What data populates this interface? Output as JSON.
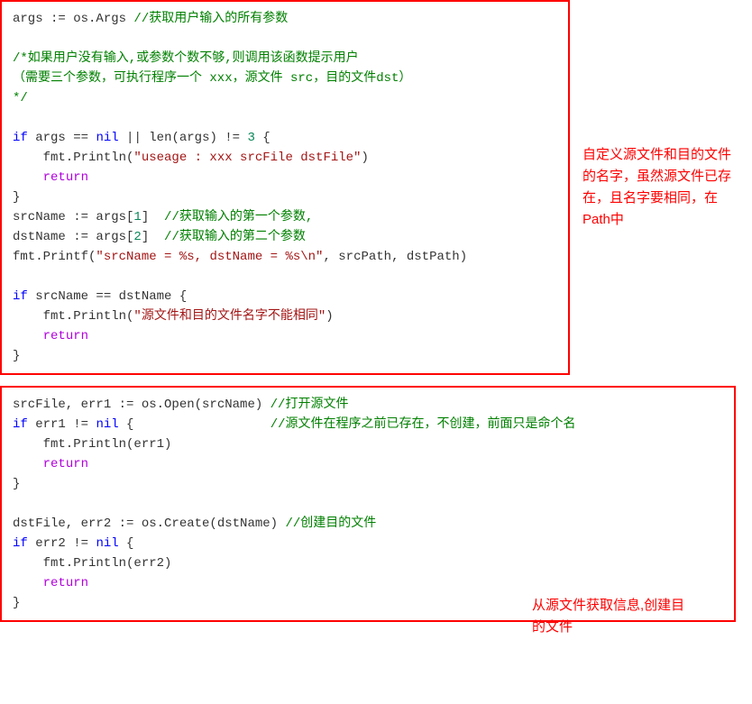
{
  "blocks": {
    "b1": {
      "l1_a": "args := os.Args ",
      "l1_c": "//获取用户输入的所有参数",
      "l2": "",
      "l3_c": "/*如果用户没有输入,或参数个数不够,则调用该函数提示用户",
      "l4_c": "（需要三个参数，可执行程序一个 xxx，源文件 src，目的文件dst）",
      "l5_c": "*/",
      "l6": "",
      "l7_a": "if",
      "l7_b": " args == ",
      "l7_nil": "nil",
      "l7_c": " || len(args) != ",
      "l7_num": "3",
      "l7_d": " {",
      "l8_a": "    fmt.Println(",
      "l8_s": "\"useage : xxx srcFile dstFile\"",
      "l8_b": ")",
      "l9_a": "    ",
      "l9_ret": "return",
      "l10": "}",
      "l11_a": "srcName := args[",
      "l11_n": "1",
      "l11_b": "]  ",
      "l11_c": "//获取输入的第一个参数,",
      "l12_a": "dstName := args[",
      "l12_n": "2",
      "l12_b": "]  ",
      "l12_c": "//获取输入的第二个参数",
      "l13_a": "fmt.Printf(",
      "l13_s": "\"srcName = %s, dstName = %s\\n\"",
      "l13_b": ", srcPath, dstPath)",
      "l14": "",
      "l15_a": "if",
      "l15_b": " srcName == dstName {",
      "l16_a": "    fmt.Println(",
      "l16_s": "\"源文件和目的文件名字不能相同\"",
      "l16_b": ")",
      "l17_a": "    ",
      "l17_ret": "return",
      "l18": "}"
    },
    "b2": {
      "l1_a": "srcFile, err1 := os.Open(srcName) ",
      "l1_c": "//打开源文件",
      "l2_a": "if",
      "l2_b": " err1 != ",
      "l2_nil": "nil",
      "l2_c": " {                  ",
      "l2_cmt": "//源文件在程序之前已存在，不创建，前面只是命个名",
      "l3": "    fmt.Println(err1)",
      "l4_a": "    ",
      "l4_ret": "return",
      "l5": "}",
      "l6": "",
      "l7_a": "dstFile, err2 := os.Create(dstName) ",
      "l7_c": "//创建目的文件",
      "l8_a": "if",
      "l8_b": " err2 != ",
      "l8_nil": "nil",
      "l8_c": " {",
      "l9": "    fmt.Println(err2)",
      "l10_a": "    ",
      "l10_ret": "return",
      "l11": "}"
    }
  },
  "annotations": {
    "a1": "自定义源文件和目的文件的名字，虽然源文件已存在，且名字要相同，在Path中",
    "a2": "从源文件获取信息,创建目的文件"
  }
}
